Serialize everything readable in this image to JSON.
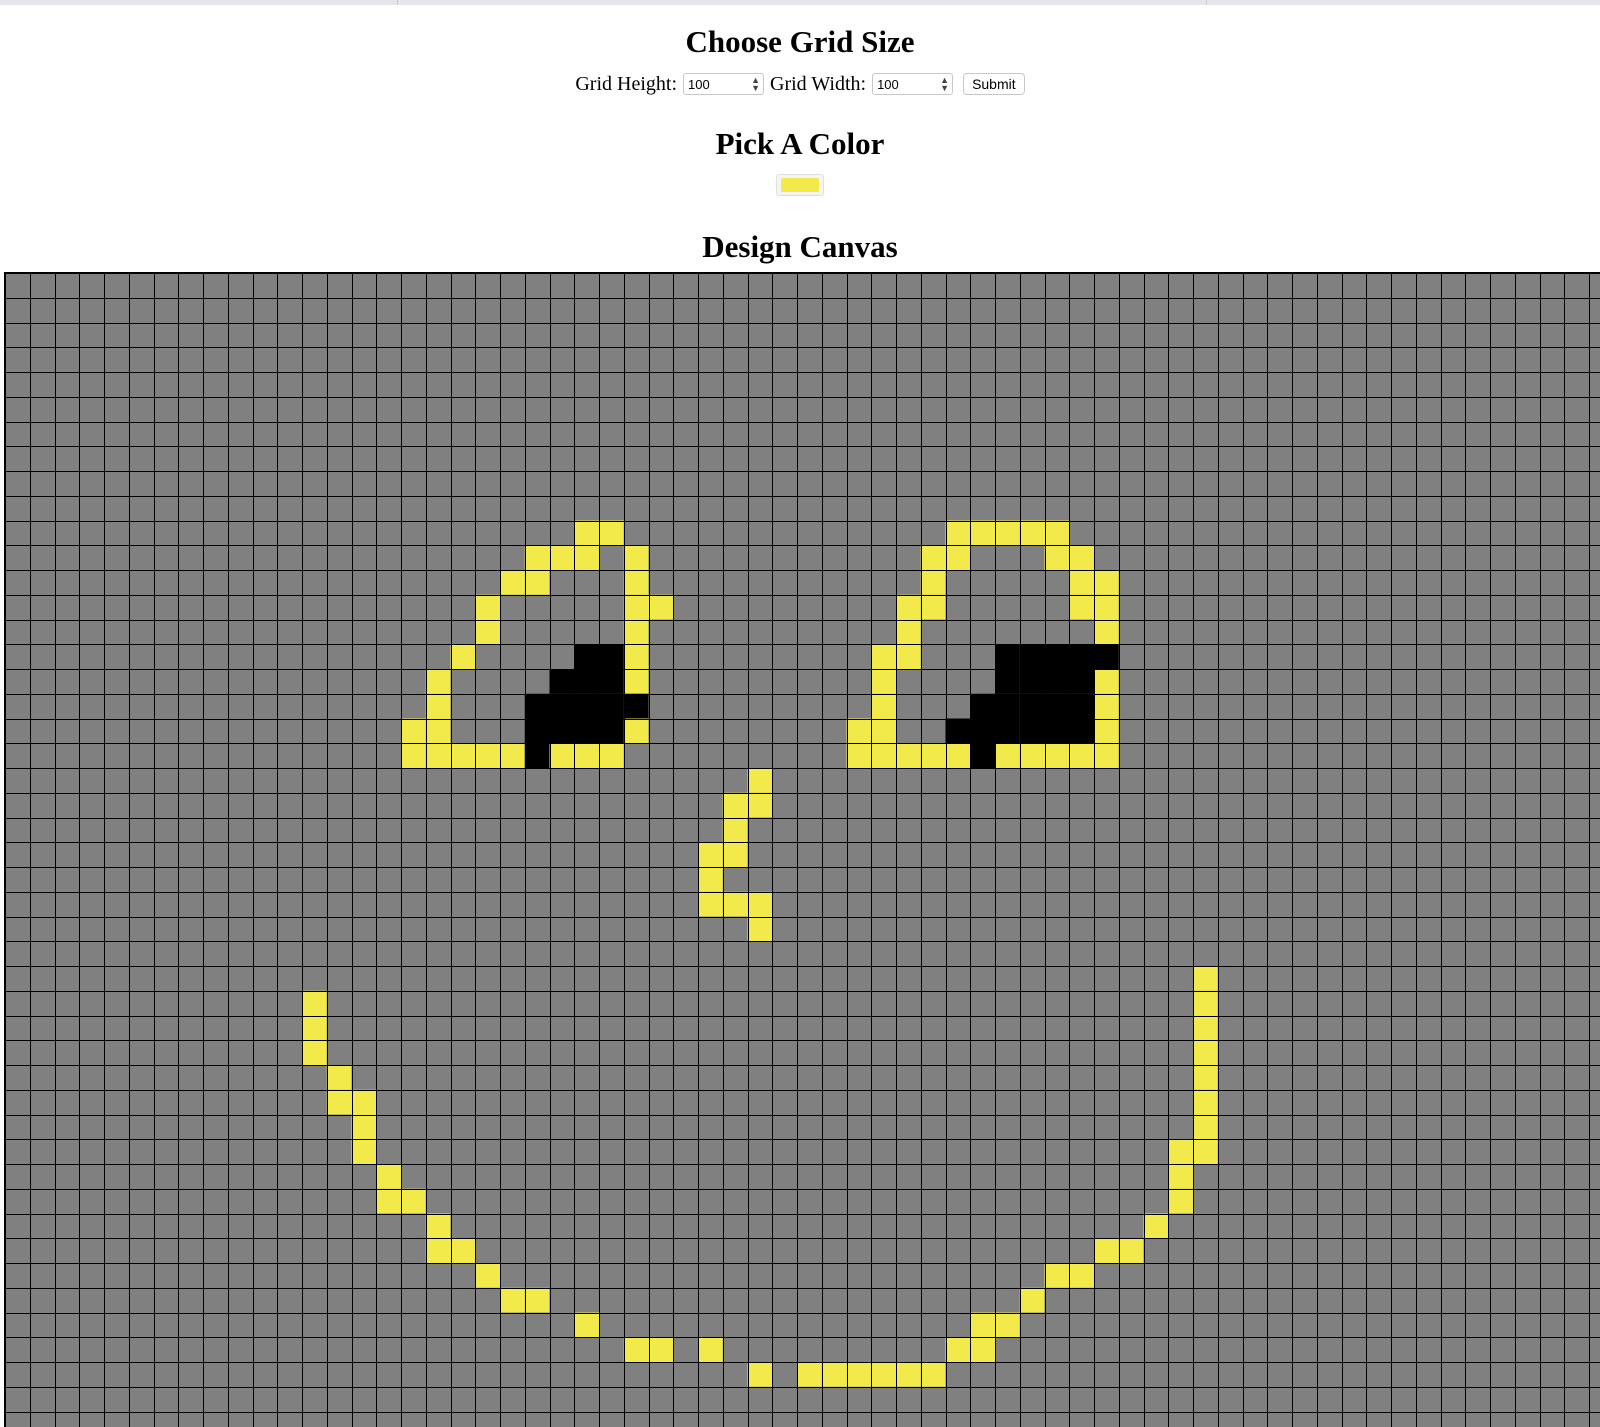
{
  "sections": {
    "grid_size_title": "Choose Grid Size",
    "color_title": "Pick A Color",
    "canvas_title": "Design Canvas"
  },
  "form": {
    "height_label": "Grid Height:",
    "height_value": "100",
    "width_label": "Grid Width:",
    "width_value": "100",
    "submit_label": "Submit"
  },
  "color_picker": {
    "value": "#f2ea4a"
  },
  "canvas": {
    "grid_rows": 100,
    "grid_cols": 100,
    "visible_rows": 46,
    "visible_cols": 64,
    "background_color": "#808080",
    "line_color": "#000000",
    "paint": [
      {
        "color": "#f2ea4a",
        "cells": [
          [
            10,
            23
          ],
          [
            10,
            24
          ],
          [
            11,
            21
          ],
          [
            11,
            22
          ],
          [
            11,
            23
          ],
          [
            11,
            25
          ],
          [
            12,
            20
          ],
          [
            12,
            21
          ],
          [
            12,
            25
          ],
          [
            13,
            19
          ],
          [
            13,
            25
          ],
          [
            13,
            26
          ],
          [
            14,
            19
          ],
          [
            14,
            25
          ],
          [
            15,
            18
          ],
          [
            15,
            25
          ],
          [
            16,
            17
          ],
          [
            16,
            25
          ],
          [
            17,
            17
          ],
          [
            18,
            16
          ],
          [
            18,
            17
          ],
          [
            18,
            25
          ],
          [
            19,
            16
          ],
          [
            19,
            17
          ],
          [
            19,
            18
          ],
          [
            19,
            19
          ],
          [
            19,
            20
          ],
          [
            19,
            21
          ],
          [
            19,
            22
          ],
          [
            19,
            23
          ],
          [
            19,
            24
          ],
          [
            10,
            38
          ],
          [
            10,
            39
          ],
          [
            10,
            40
          ],
          [
            10,
            41
          ],
          [
            10,
            42
          ],
          [
            11,
            37
          ],
          [
            11,
            38
          ],
          [
            11,
            42
          ],
          [
            11,
            43
          ],
          [
            12,
            37
          ],
          [
            12,
            43
          ],
          [
            12,
            44
          ],
          [
            13,
            36
          ],
          [
            13,
            37
          ],
          [
            13,
            43
          ],
          [
            13,
            44
          ],
          [
            14,
            36
          ],
          [
            14,
            44
          ],
          [
            15,
            35
          ],
          [
            15,
            36
          ],
          [
            16,
            35
          ],
          [
            16,
            44
          ],
          [
            17,
            35
          ],
          [
            17,
            44
          ],
          [
            18,
            34
          ],
          [
            18,
            35
          ],
          [
            18,
            44
          ],
          [
            19,
            34
          ],
          [
            19,
            35
          ],
          [
            19,
            36
          ],
          [
            19,
            37
          ],
          [
            19,
            38
          ],
          [
            19,
            39
          ],
          [
            19,
            40
          ],
          [
            19,
            41
          ],
          [
            19,
            42
          ],
          [
            19,
            43
          ],
          [
            19,
            44
          ],
          [
            20,
            30
          ],
          [
            21,
            29
          ],
          [
            21,
            30
          ],
          [
            22,
            29
          ],
          [
            23,
            28
          ],
          [
            23,
            29
          ],
          [
            24,
            28
          ],
          [
            25,
            28
          ],
          [
            25,
            29
          ],
          [
            25,
            30
          ],
          [
            26,
            30
          ],
          [
            28,
            48
          ],
          [
            29,
            12
          ],
          [
            29,
            48
          ],
          [
            30,
            12
          ],
          [
            30,
            48
          ],
          [
            31,
            12
          ],
          [
            31,
            48
          ],
          [
            32,
            13
          ],
          [
            32,
            48
          ],
          [
            33,
            13
          ],
          [
            33,
            14
          ],
          [
            33,
            48
          ],
          [
            34,
            14
          ],
          [
            34,
            48
          ],
          [
            35,
            14
          ],
          [
            35,
            47
          ],
          [
            35,
            48
          ],
          [
            36,
            15
          ],
          [
            36,
            47
          ],
          [
            37,
            15
          ],
          [
            37,
            16
          ],
          [
            37,
            47
          ],
          [
            38,
            17
          ],
          [
            38,
            46
          ],
          [
            39,
            17
          ],
          [
            39,
            18
          ],
          [
            39,
            44
          ],
          [
            39,
            45
          ],
          [
            40,
            19
          ],
          [
            40,
            42
          ],
          [
            40,
            43
          ],
          [
            41,
            20
          ],
          [
            41,
            21
          ],
          [
            41,
            41
          ],
          [
            42,
            23
          ],
          [
            42,
            39
          ],
          [
            42,
            40
          ],
          [
            43,
            25
          ],
          [
            43,
            26
          ],
          [
            43,
            28
          ],
          [
            43,
            38
          ],
          [
            43,
            39
          ],
          [
            44,
            30
          ],
          [
            44,
            32
          ],
          [
            44,
            33
          ],
          [
            44,
            34
          ],
          [
            44,
            35
          ],
          [
            44,
            36
          ],
          [
            44,
            37
          ]
        ]
      },
      {
        "color": "#000000",
        "cells": [
          [
            15,
            23
          ],
          [
            15,
            24
          ],
          [
            16,
            22
          ],
          [
            16,
            23
          ],
          [
            16,
            24
          ],
          [
            17,
            21
          ],
          [
            17,
            22
          ],
          [
            17,
            23
          ],
          [
            17,
            24
          ],
          [
            17,
            25
          ],
          [
            18,
            21
          ],
          [
            18,
            22
          ],
          [
            18,
            23
          ],
          [
            18,
            24
          ],
          [
            19,
            21
          ],
          [
            15,
            40
          ],
          [
            15,
            41
          ],
          [
            15,
            42
          ],
          [
            15,
            43
          ],
          [
            15,
            44
          ],
          [
            16,
            40
          ],
          [
            16,
            41
          ],
          [
            16,
            42
          ],
          [
            16,
            43
          ],
          [
            17,
            39
          ],
          [
            17,
            40
          ],
          [
            17,
            41
          ],
          [
            17,
            42
          ],
          [
            17,
            43
          ],
          [
            18,
            38
          ],
          [
            18,
            39
          ],
          [
            18,
            40
          ],
          [
            18,
            41
          ],
          [
            18,
            42
          ],
          [
            18,
            43
          ],
          [
            19,
            39
          ]
        ]
      }
    ]
  }
}
